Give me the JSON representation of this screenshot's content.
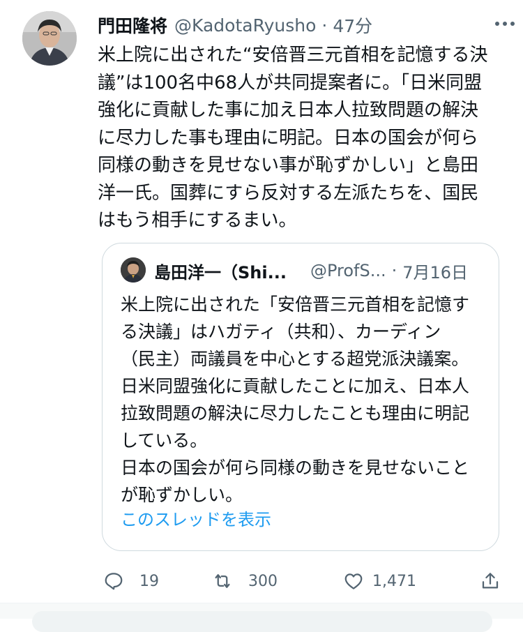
{
  "tweet": {
    "author_name": "門田隆将",
    "author_handle": "@KadotaRyusho",
    "separator": "·",
    "time": "47分",
    "text": "米上院に出された“安倍晋三元首相を記憶する決\n議”は100名中68人が共同提案者に。「日米同盟\n強化に貢献した事に加え日本人拉致問題の解決\nに尽力した事も理由に明記。日本の国会が何ら\n同様の動きを見せない事が恥ずかしい」と島田\n洋一氏。国葬にすら反対する左派たちを、国民\nはもう相手にするまい。"
  },
  "quote": {
    "author_name": "島田洋一（Shi...",
    "author_handle": "@ProfS...",
    "separator": "·",
    "date": "7月16日",
    "text": "米上院に出された「安倍晋三元首相を記憶す\nる決議」はハガティ（共和）、カーディン\n（民主）両議員を中心とする超党派決議案。\n日米同盟強化に貢献したことに加え、日本人\n拉致問題の解決に尽力したことも理由に明記\nしている。\n日本の国会が何ら同様の動きを見せないこと\nが恥ずかしい。",
    "show_thread": "このスレッドを表示"
  },
  "actions": {
    "reply_count": "19",
    "retweet_count": "300",
    "like_count": "1,471"
  },
  "icons": {
    "more": "more-icon",
    "reply": "reply-icon",
    "retweet": "retweet-icon",
    "like": "heart-icon",
    "share": "share-icon"
  },
  "colors": {
    "text": "#0f1419",
    "secondary": "#536471",
    "link": "#1d9bf0",
    "border": "#cfd9de"
  }
}
